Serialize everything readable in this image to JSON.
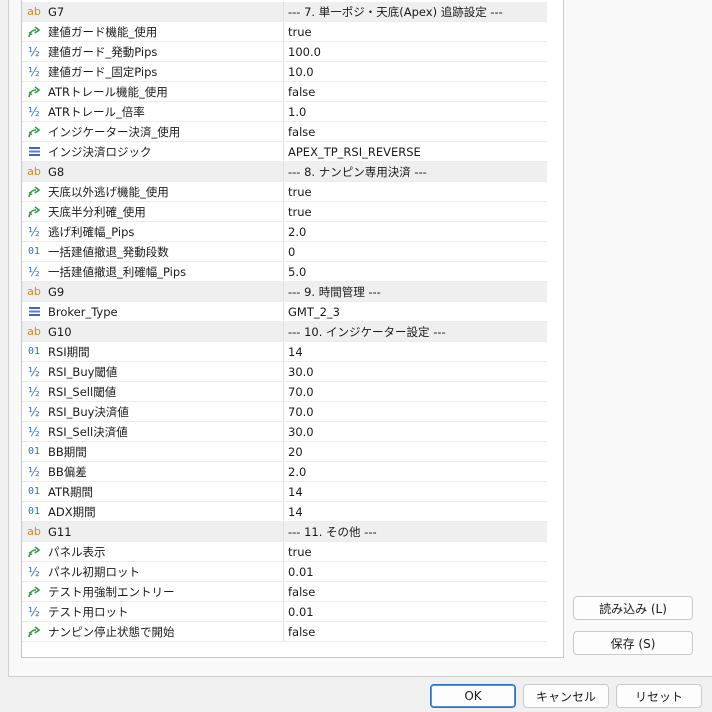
{
  "rows": [
    {
      "type": "group",
      "icon": "ab",
      "name": "G7",
      "value": "--- 7. 単一ポジ・天底(Apex) 追跡設定 ---"
    },
    {
      "type": "param",
      "icon": "bool",
      "name": "建値ガード機能_使用",
      "value": "true"
    },
    {
      "type": "param",
      "icon": "half",
      "name": "建値ガード_発動Pips",
      "value": "100.0"
    },
    {
      "type": "param",
      "icon": "half",
      "name": "建値ガード_固定Pips",
      "value": "10.0"
    },
    {
      "type": "param",
      "icon": "bool",
      "name": "ATRトレール機能_使用",
      "value": "false"
    },
    {
      "type": "param",
      "icon": "half",
      "name": "ATRトレール_倍率",
      "value": "1.0"
    },
    {
      "type": "param",
      "icon": "bool",
      "name": "インジケーター決済_使用",
      "value": "false"
    },
    {
      "type": "param",
      "icon": "enum",
      "name": "インジ決済ロジック",
      "value": "APEX_TP_RSI_REVERSE"
    },
    {
      "type": "group",
      "icon": "ab",
      "name": "G8",
      "value": "--- 8. ナンピン専用決済 ---"
    },
    {
      "type": "param",
      "icon": "bool",
      "name": "天底以外逃げ機能_使用",
      "value": "true"
    },
    {
      "type": "param",
      "icon": "bool",
      "name": "天底半分利確_使用",
      "value": "true"
    },
    {
      "type": "param",
      "icon": "half",
      "name": "逃げ利確幅_Pips",
      "value": "2.0"
    },
    {
      "type": "param",
      "icon": "01",
      "name": "一括建値撤退_発動段数",
      "value": "0"
    },
    {
      "type": "param",
      "icon": "half",
      "name": "一括建値撤退_利確幅_Pips",
      "value": "5.0"
    },
    {
      "type": "group",
      "icon": "ab",
      "name": "G9",
      "value": "--- 9. 時間管理 ---"
    },
    {
      "type": "param",
      "icon": "enum",
      "name": "Broker_Type",
      "value": "GMT_2_3"
    },
    {
      "type": "group",
      "icon": "ab",
      "name": "G10",
      "value": "--- 10. インジケーター設定 ---"
    },
    {
      "type": "param",
      "icon": "01",
      "name": "RSI期間",
      "value": "14"
    },
    {
      "type": "param",
      "icon": "half",
      "name": "RSI_Buy閾値",
      "value": "30.0"
    },
    {
      "type": "param",
      "icon": "half",
      "name": "RSI_Sell閾値",
      "value": "70.0"
    },
    {
      "type": "param",
      "icon": "half",
      "name": "RSI_Buy決済値",
      "value": "70.0"
    },
    {
      "type": "param",
      "icon": "half",
      "name": "RSI_Sell決済値",
      "value": "30.0"
    },
    {
      "type": "param",
      "icon": "01",
      "name": "BB期間",
      "value": "20"
    },
    {
      "type": "param",
      "icon": "half",
      "name": "BB偏差",
      "value": "2.0"
    },
    {
      "type": "param",
      "icon": "01",
      "name": "ATR期間",
      "value": "14"
    },
    {
      "type": "param",
      "icon": "01",
      "name": "ADX期間",
      "value": "14"
    },
    {
      "type": "group",
      "icon": "ab",
      "name": "G11",
      "value": "--- 11. その他 ---"
    },
    {
      "type": "param",
      "icon": "bool",
      "name": "パネル表示",
      "value": "true"
    },
    {
      "type": "param",
      "icon": "half",
      "name": "パネル初期ロット",
      "value": "0.01"
    },
    {
      "type": "param",
      "icon": "bool",
      "name": "テスト用強制エントリー",
      "value": "false"
    },
    {
      "type": "param",
      "icon": "half",
      "name": "テスト用ロット",
      "value": "0.01"
    },
    {
      "type": "param",
      "icon": "bool",
      "name": "ナンピン停止状態で開始",
      "value": "false"
    }
  ],
  "side_buttons": {
    "load": "読み込み (L)",
    "save": "保存 (S)"
  },
  "footer": {
    "ok": "OK",
    "cancel": "キャンセル",
    "reset": "リセット"
  },
  "icon_glyphs": {
    "ab": "ab",
    "half": "½",
    "01": "01"
  },
  "colors": {
    "icon_orange": "#c8872a",
    "icon_blue": "#2d6ec8",
    "icon_green": "#2f9a3a",
    "group_bg": "#efefef"
  }
}
